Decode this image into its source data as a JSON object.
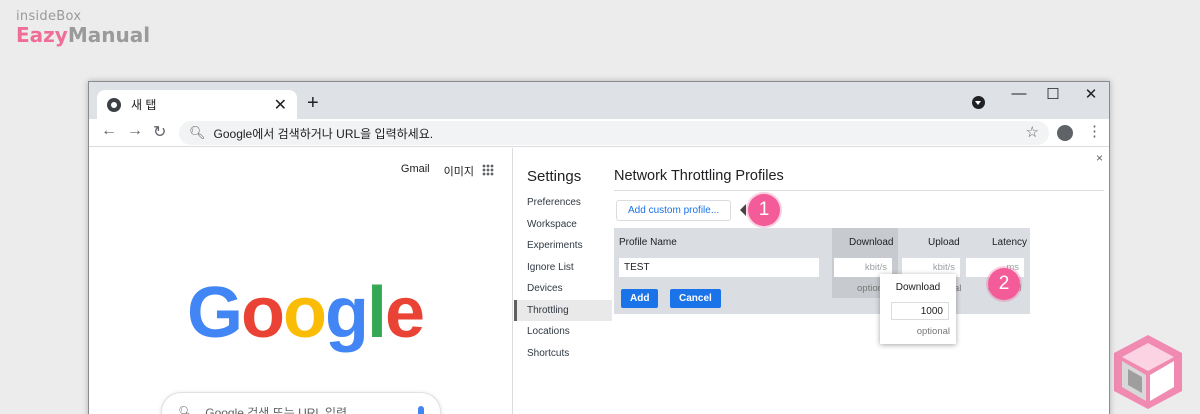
{
  "brand": {
    "line1": "insideBox",
    "line2_pink": "Eazy",
    "line2_rest": "Manual"
  },
  "browser": {
    "tab_title": "새 탭",
    "tab_close": "✕",
    "new_tab": "+",
    "window_controls": {
      "minimize": "—",
      "maximize": "☐",
      "close": "✕"
    },
    "nav": {
      "back": "←",
      "forward": "→",
      "reload": "↻"
    },
    "omnibox_placeholder": "Google에서 검색하거나 URL을 입력하세요.",
    "star": "☆",
    "menu": "⋮"
  },
  "google": {
    "links": [
      "Gmail",
      "이미지"
    ],
    "logo": [
      {
        "ch": "G",
        "color": "#4285F4"
      },
      {
        "ch": "o",
        "color": "#EA4335"
      },
      {
        "ch": "o",
        "color": "#FBBC05"
      },
      {
        "ch": "g",
        "color": "#4285F4"
      },
      {
        "ch": "l",
        "color": "#34A853"
      },
      {
        "ch": "e",
        "color": "#EA4335"
      }
    ],
    "search_placeholder": "Google 검색 또는 URL 입력"
  },
  "devtools": {
    "close": "×",
    "settings_title": "Settings",
    "nav_items": [
      "Preferences",
      "Workspace",
      "Experiments",
      "Ignore List",
      "Devices",
      "Throttling",
      "Locations",
      "Shortcuts"
    ],
    "selected_nav": "Throttling",
    "section_title": "Network Throttling Profiles",
    "add_button": "Add custom profile...",
    "editor": {
      "headers": {
        "name": "Profile Name",
        "download": "Download",
        "upload": "Upload",
        "latency": "Latency"
      },
      "name_value": "TEST",
      "download_unit": "kbit/s",
      "upload_unit": "kbit/s",
      "latency_unit": "ms",
      "optional": "optional",
      "optional_partial": "al",
      "add": "Add",
      "cancel": "Cancel"
    },
    "popup": {
      "label": "Download",
      "value": "1000",
      "optional": "optional"
    }
  },
  "badges": [
    "1",
    "2"
  ],
  "colors": {
    "badge": "#F35C98",
    "accent_blue": "#1A73E8",
    "brand_pink": "#EE6E97"
  }
}
